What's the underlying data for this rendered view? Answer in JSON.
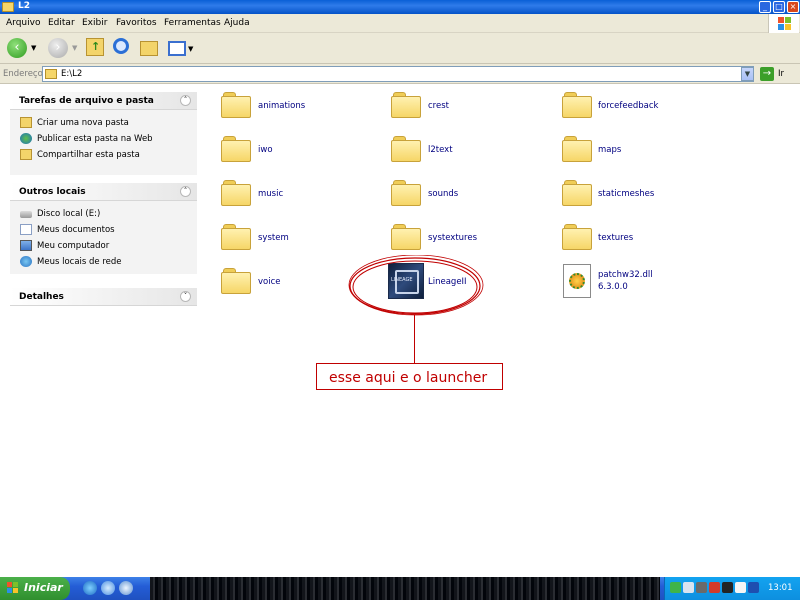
{
  "window": {
    "title": "L2"
  },
  "menu": [
    "Arquivo",
    "Editar",
    "Exibir",
    "Favoritos",
    "Ferramentas",
    "Ajuda"
  ],
  "address": {
    "label": "Endereço",
    "value": "E:\\L2",
    "go_label": "Ir"
  },
  "panels": {
    "tasks": {
      "title": "Tarefas de arquivo e pasta",
      "items": [
        "Criar uma nova pasta",
        "Publicar esta pasta na Web",
        "Compartilhar esta pasta"
      ]
    },
    "places": {
      "title": "Outros locais",
      "items": [
        "Disco local (E:)",
        "Meus documentos",
        "Meu computador",
        "Meus locais de rede"
      ]
    },
    "details": {
      "title": "Detalhes"
    }
  },
  "folders": [
    "animations",
    "crest",
    "forcefeedback",
    "iwo",
    "l2text",
    "maps",
    "music",
    "sounds",
    "staticmeshes",
    "system",
    "systextures",
    "textures",
    "voice"
  ],
  "files": {
    "lineage": {
      "name": "LineageII",
      "icon_text": "LINEAGE"
    },
    "patch": {
      "name": "patchw32.dll",
      "version": "6.3.0.0"
    }
  },
  "annotation": {
    "text": "esse aqui e o launcher",
    "color": "#c00000"
  },
  "taskbar": {
    "start_label": "Iniciar",
    "clock": "13:01"
  },
  "colors": {
    "title_bar": "#0a5fd6",
    "taskbar": "#245dd6",
    "start": "#3a9b39",
    "link": "#000080"
  }
}
